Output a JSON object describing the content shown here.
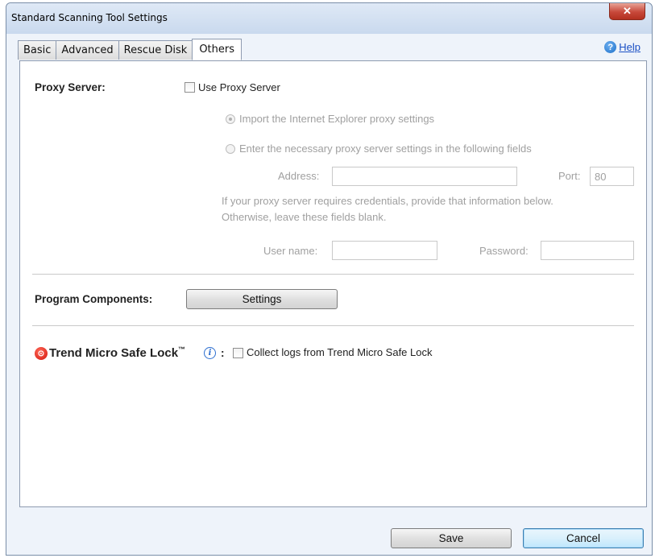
{
  "window": {
    "title": "Standard Scanning Tool Settings",
    "close_symbol": "✕"
  },
  "tabs": [
    {
      "label": "Basic",
      "active": false
    },
    {
      "label": "Advanced",
      "active": false
    },
    {
      "label": "Rescue Disk",
      "active": false
    },
    {
      "label": "Others",
      "active": true
    }
  ],
  "help": {
    "label": "Help",
    "icon": "help-icon"
  },
  "proxy": {
    "section_label": "Proxy Server:",
    "use_proxy_label": "Use Proxy Server",
    "use_proxy_checked": false,
    "radio_ie_label": "Import the Internet Explorer proxy settings",
    "radio_ie_selected": true,
    "radio_manual_label": "Enter the necessary proxy server settings in the following fields",
    "radio_manual_selected": false,
    "address_label": "Address:",
    "address_value": "",
    "port_label": "Port:",
    "port_value": "80",
    "credentials_note_line1": "If your proxy server requires credentials, provide that information below.",
    "credentials_note_line2": "Otherwise, leave these fields blank.",
    "username_label": "User name:",
    "username_value": "",
    "password_label": "Password:",
    "password_value": ""
  },
  "components": {
    "section_label": "Program Components:",
    "settings_button": "Settings"
  },
  "safelock": {
    "label": "Trend Micro Safe Lock",
    "trademark": "™",
    "suffix": ":",
    "collect_logs_label": "Collect logs from Trend Micro Safe Lock",
    "collect_logs_checked": false
  },
  "footer": {
    "save_button": "Save",
    "cancel_button": "Cancel"
  },
  "colors": {
    "window_bg": "#eef3fa",
    "disabled_text": "#a0a0a0",
    "link": "#1a4fc4",
    "close_button": "#c7483a"
  }
}
